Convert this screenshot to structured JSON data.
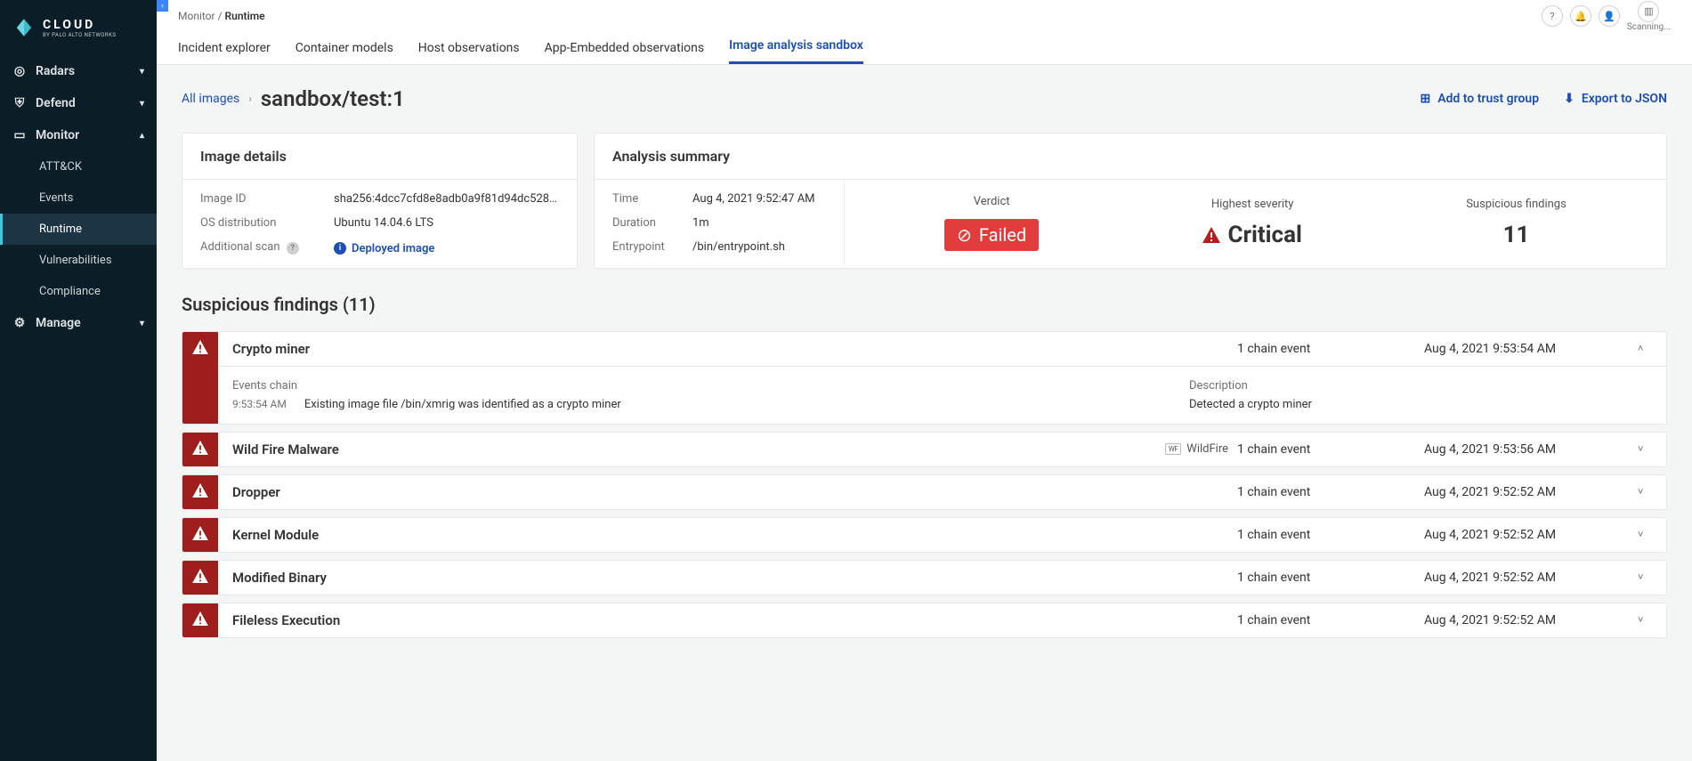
{
  "brand": {
    "top": "CLOUD",
    "bottom": "BY PALO ALTO NETWORKS"
  },
  "header": {
    "scanning": "Scanning...",
    "breadcrumb": {
      "root": "Monitor",
      "sep": "/",
      "current": "Runtime"
    }
  },
  "sidebar": {
    "items": [
      {
        "label": "Radars",
        "chev": "▾",
        "icon": "globe"
      },
      {
        "label": "Defend",
        "chev": "▾",
        "icon": "shield"
      },
      {
        "label": "Monitor",
        "chev": "▴",
        "icon": "monitor"
      },
      {
        "label": "Manage",
        "chev": "▾",
        "icon": "gear"
      }
    ],
    "monitor_children": [
      {
        "label": "ATT&CK"
      },
      {
        "label": "Events"
      },
      {
        "label": "Runtime"
      },
      {
        "label": "Vulnerabilities"
      },
      {
        "label": "Compliance"
      }
    ]
  },
  "tabs": [
    {
      "label": "Incident explorer"
    },
    {
      "label": "Container models"
    },
    {
      "label": "Host observations"
    },
    {
      "label": "App-Embedded observations"
    },
    {
      "label": "Image analysis sandbox"
    }
  ],
  "title_row": {
    "all": "All images",
    "page_title": "sandbox/test:1",
    "add_to_trust": "Add to trust group",
    "export_json": "Export to JSON"
  },
  "image_details": {
    "header": "Image details",
    "rows": [
      {
        "label": "Image ID",
        "value": "sha256:4dcc7cfd8e8adb0a9f81d94dc528d7d..."
      },
      {
        "label": "OS distribution",
        "value": "Ubuntu 14.04.6 LTS"
      },
      {
        "label": "Additional scan",
        "value": "Deployed image",
        "help": true,
        "link": true
      }
    ]
  },
  "analysis_summary": {
    "header": "Analysis summary",
    "left": [
      {
        "label": "Time",
        "value": "Aug 4, 2021 9:52:47 AM"
      },
      {
        "label": "Duration",
        "value": "1m"
      },
      {
        "label": "Entrypoint",
        "value": "/bin/entrypoint.sh"
      }
    ],
    "stats": {
      "verdict": {
        "label": "Verdict",
        "value": "Failed"
      },
      "severity": {
        "label": "Highest severity",
        "value": "Critical"
      },
      "count": {
        "label": "Suspicious findings",
        "value": "11"
      }
    }
  },
  "findings_header": "Suspicious findings (11)",
  "findings": [
    {
      "title": "Crypto miner",
      "chain": "1 chain event",
      "time": "Aug 4, 2021 9:53:54 AM",
      "expanded": true,
      "events_label": "Events chain",
      "desc_label": "Description",
      "event_time": "9:53:54 AM",
      "event_text": "Existing image file /bin/xmrig was identified as a crypto miner",
      "description": "Detected a crypto miner"
    },
    {
      "title": "Wild Fire Malware",
      "chain": "1 chain event",
      "time": "Aug 4, 2021 9:53:56 AM",
      "wildfire": "WildFire"
    },
    {
      "title": "Dropper",
      "chain": "1 chain event",
      "time": "Aug 4, 2021 9:52:52 AM"
    },
    {
      "title": "Kernel Module",
      "chain": "1 chain event",
      "time": "Aug 4, 2021 9:52:52 AM"
    },
    {
      "title": "Modified Binary",
      "chain": "1 chain event",
      "time": "Aug 4, 2021 9:52:52 AM"
    },
    {
      "title": "Fileless Execution",
      "chain": "1 chain event",
      "time": "Aug 4, 2021 9:52:52 AM"
    }
  ]
}
